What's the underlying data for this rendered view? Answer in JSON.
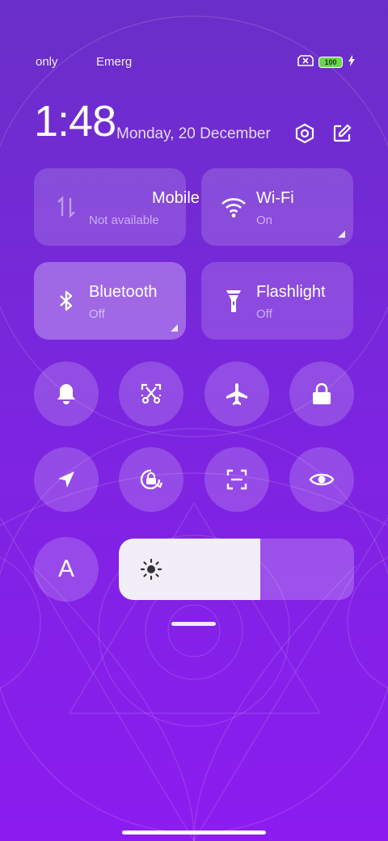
{
  "status_bar": {
    "carrier_1": "only",
    "carrier_2": "Emerg",
    "battery_level": "100",
    "charging_icon": "bolt-icon",
    "sim_icon": "no-sim-icon"
  },
  "header": {
    "time": "1:48",
    "date": "Monday, 20 December",
    "settings_icon": "settings-hexagon-icon",
    "edit_icon": "edit-icon"
  },
  "tiles": [
    {
      "title": "Mobile",
      "subtitle": "Not available",
      "icon": "mobile-data-icon",
      "active": false
    },
    {
      "title": "Wi-Fi",
      "subtitle": "On",
      "icon": "wifi-icon",
      "active": false
    },
    {
      "title": "Bluetooth",
      "subtitle": "Off",
      "icon": "bluetooth-icon",
      "active": true
    },
    {
      "title": "Flashlight",
      "subtitle": "Off",
      "icon": "flashlight-icon",
      "active": false
    }
  ],
  "toggles_row1": [
    "bell-icon",
    "screenshot-icon",
    "airplane-icon",
    "lock-icon"
  ],
  "toggles_row2": [
    "location-icon",
    "rotation-lock-icon",
    "scan-icon",
    "eye-icon"
  ],
  "auto_brightness_label": "A",
  "brightness": {
    "level": 0.6,
    "icon": "sun-icon"
  },
  "colors": {
    "background_top": "#6a2fc8",
    "background_bottom": "#8c1cf0",
    "slider_fill": "#f2eef8"
  }
}
